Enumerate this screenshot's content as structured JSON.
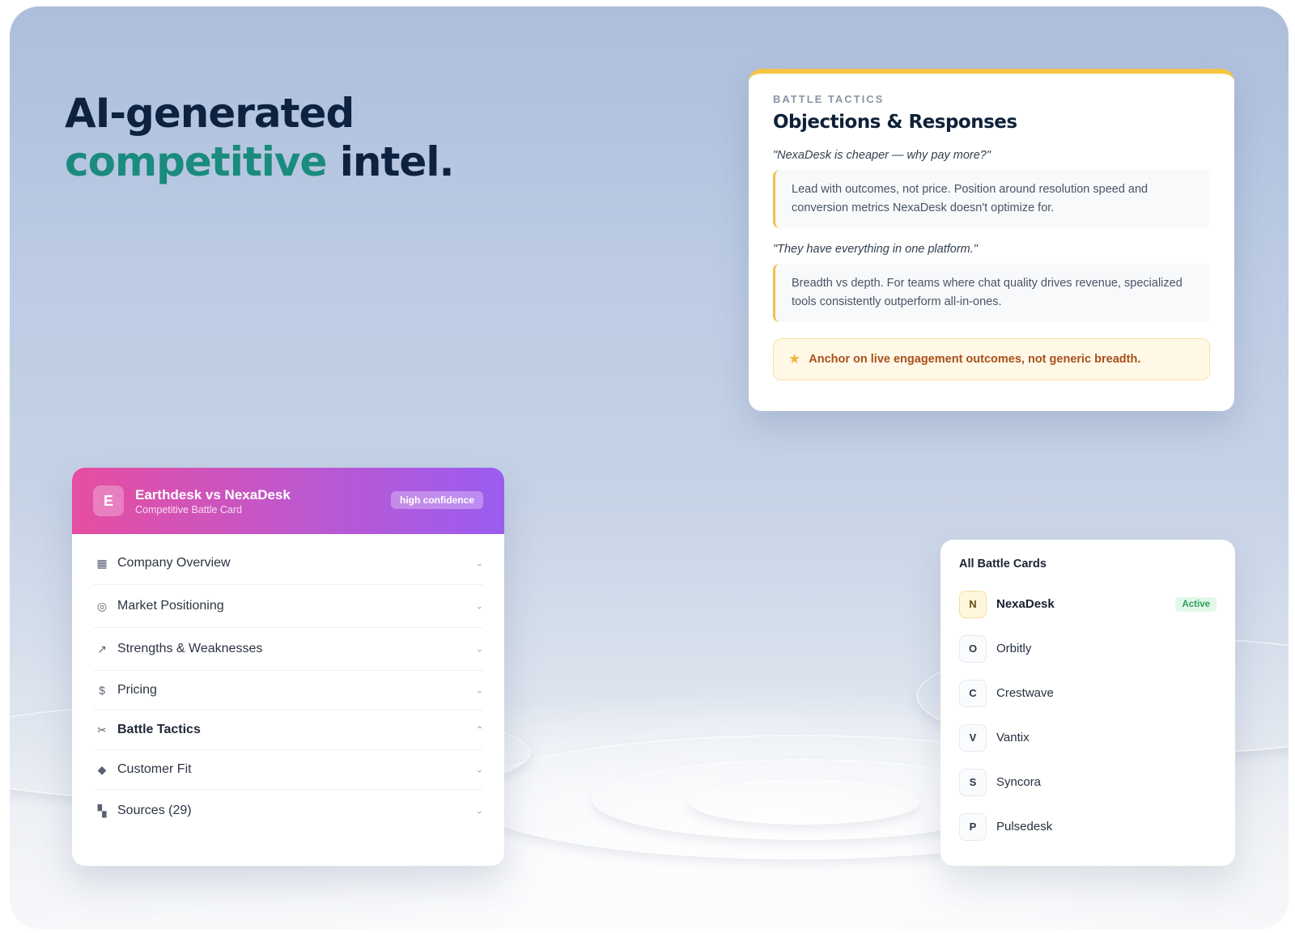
{
  "hero": {
    "line1": "AI-generated",
    "line2_accent": "competitive",
    "line2_rest": " intel."
  },
  "tactics": {
    "eyebrow": "BATTLE TACTICS",
    "title": "Objections & Responses",
    "objections": [
      {
        "quote": "\"NexaDesk is cheaper — why pay more?\"",
        "response": "Lead with outcomes, not price. Position around resolution speed and conversion metrics NexaDesk doesn't optimize for."
      },
      {
        "quote": "\"They have everything in one platform.\"",
        "response": "Breadth vs depth. For teams where chat quality drives revenue, specialized tools consistently outperform all-in-ones."
      }
    ],
    "anchor_icon": "star-icon",
    "anchor": "Anchor on live engagement outcomes, not generic breadth."
  },
  "battle_card": {
    "avatar": "E",
    "title": "Earthdesk vs NexaDesk",
    "subtitle": "Competitive Battle Card",
    "confidence": "high confidence",
    "colors": {
      "gradient_start": "#e64ea0",
      "gradient_end": "#9a5cf0"
    },
    "sections": [
      {
        "icon": "building-icon",
        "glyph": "▦",
        "label": "Company Overview",
        "chevron": "⌄"
      },
      {
        "icon": "target-icon",
        "glyph": "◎",
        "label": "Market Positioning",
        "chevron": "⌄"
      },
      {
        "icon": "trend-icon",
        "glyph": "↗",
        "label": "Strengths & Weaknesses",
        "chevron": "⌄"
      },
      {
        "icon": "dollar-icon",
        "glyph": "$",
        "label": "Pricing",
        "chevron": "⌄"
      },
      {
        "icon": "swords-icon",
        "glyph": "✂",
        "label": "Battle Tactics",
        "chevron": "⌃"
      },
      {
        "icon": "diamond-icon",
        "glyph": "◆",
        "label": "Customer Fit",
        "chevron": "⌄"
      },
      {
        "icon": "file-icon",
        "glyph": "▚",
        "label": "Sources (29)",
        "chevron": "⌄"
      }
    ]
  },
  "all_cards": {
    "title": "All Battle Cards",
    "items": [
      {
        "letter": "N",
        "name": "NexaDesk",
        "badge": "Active"
      },
      {
        "letter": "O",
        "name": "Orbitly"
      },
      {
        "letter": "C",
        "name": "Crestwave"
      },
      {
        "letter": "V",
        "name": "Vantix"
      },
      {
        "letter": "S",
        "name": "Syncora"
      },
      {
        "letter": "P",
        "name": "Pulsedesk"
      }
    ]
  },
  "colors": {
    "headline": "#0d2240",
    "accent": "#1a8b7c",
    "highlight_bar": "#f5c542",
    "anchor_text": "#a8501a"
  }
}
